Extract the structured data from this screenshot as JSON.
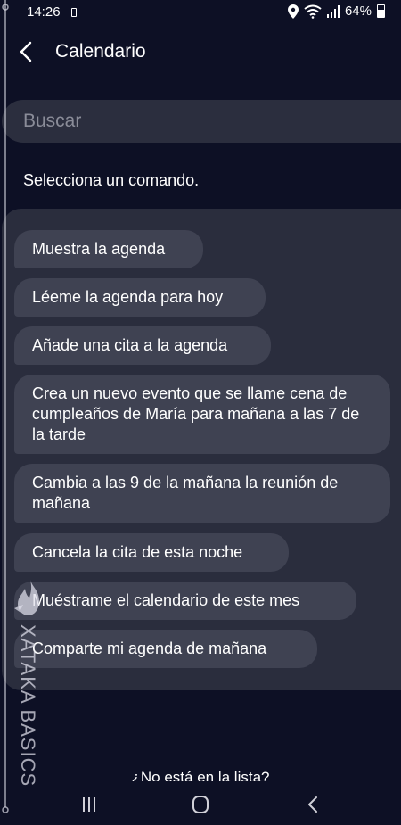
{
  "status_bar": {
    "time": "14:26",
    "battery": "64%",
    "battery_level": 0.64
  },
  "header": {
    "title": "Calendario"
  },
  "search": {
    "placeholder": "Buscar"
  },
  "prompt": "Selecciona un comando.",
  "commands": [
    "Muestra la agenda",
    "Léeme la agenda para hoy",
    "Añade una cita a la agenda",
    "Crea un nuevo evento que se llame cena de cumpleaños de María para mañana a las 7 de la tarde",
    "Cambia a las 9 de la mañana la reunión de mañana",
    "Cancela la cita de esta noche",
    "Muéstrame el calendario de este mes",
    "Comparte mi agenda de mañana"
  ],
  "footer": {
    "not_in_list": "¿No está en la lista?"
  },
  "watermark": {
    "text": "XATAKA BASICS"
  },
  "icons": {
    "back": "back-arrow-icon",
    "location": "location-pin-icon",
    "wifi": "wifi-icon",
    "signal": "signal-icon",
    "battery": "battery-icon",
    "recents": "recents-icon",
    "home": "home-icon",
    "nav_back": "nav-back-icon"
  }
}
